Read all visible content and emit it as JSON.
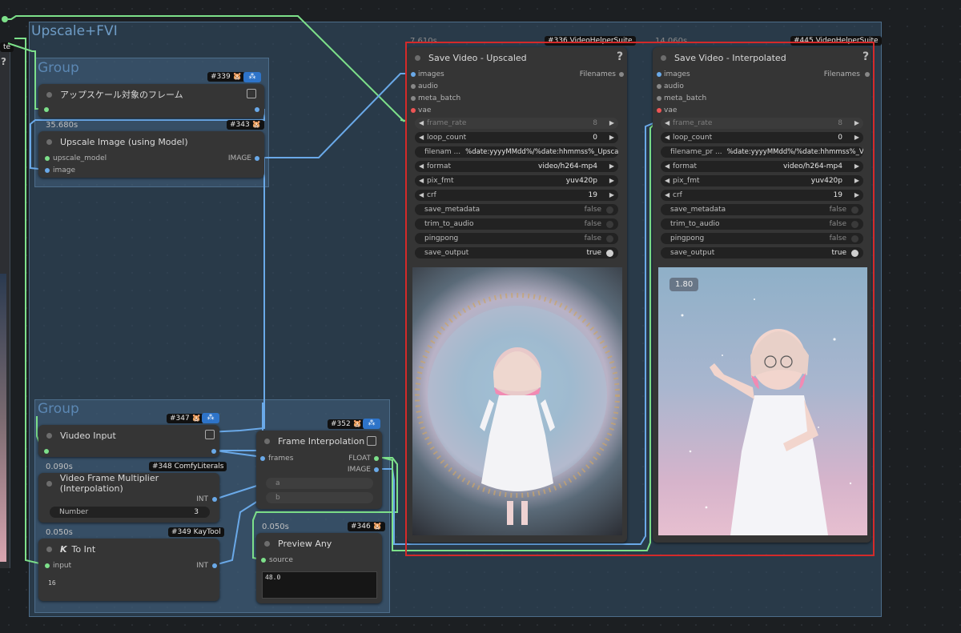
{
  "outer_group": {
    "title": "Upscale+FVI"
  },
  "group1": {
    "title": "Group"
  },
  "group2": {
    "title": "Group"
  },
  "node_339": {
    "id": "#339 🐹",
    "title": "アップスケール対象のフレーム"
  },
  "node_343": {
    "time": "35.680s",
    "id": "#343 🐹",
    "title": "Upscale Image (using Model)",
    "inputs": [
      "upscale_model",
      "image"
    ],
    "output": "IMAGE"
  },
  "node_347": {
    "id": "#347 🐹",
    "title": "Viudeo Input"
  },
  "node_348": {
    "time": "0.090s",
    "id": "#348 ComfyLiterals",
    "title": "Video Frame Multiplier (Interpolation)",
    "output": "INT",
    "widget_label": "Number",
    "widget_value": "3"
  },
  "node_349": {
    "time": "0.050s",
    "id": "#349 KayTool",
    "title": "To Int",
    "title_icon": "K",
    "input": "input",
    "output": "INT",
    "text": "16"
  },
  "node_352": {
    "id": "#352 🐹",
    "title": "Frame Interpolation",
    "input": "frames",
    "outputs": [
      "FLOAT",
      "IMAGE"
    ],
    "widgets": [
      "a",
      "b"
    ]
  },
  "node_346": {
    "time": "0.050s",
    "id": "#346 🐹",
    "title": "Preview Any",
    "input": "source",
    "text": "48.0"
  },
  "node_336": {
    "time": "7.610s",
    "id": "#336 VideoHelperSuite",
    "title": "Save Video - Upscaled",
    "help": "?",
    "inputs": [
      "images",
      "audio",
      "meta_batch",
      "vae"
    ],
    "output": "Filenames",
    "frame_rate_label": "frame_rate",
    "frame_rate_value": "8",
    "loop_count_label": "loop_count",
    "loop_count_value": "0",
    "filename_label": "filenam ...",
    "filename_value": "%date:yyyyMMdd%/%date:hhmmss%_Upscale",
    "format_label": "format",
    "format_value": "video/h264-mp4",
    "pix_fmt_label": "pix_fmt",
    "pix_fmt_value": "yuv420p",
    "crf_label": "crf",
    "crf_value": "19",
    "toggles": [
      {
        "label": "save_metadata",
        "value": "false"
      },
      {
        "label": "trim_to_audio",
        "value": "false"
      },
      {
        "label": "pingpong",
        "value": "false"
      },
      {
        "label": "save_output",
        "value": "true"
      }
    ]
  },
  "node_445": {
    "time": "14.060s",
    "id": "#445 VideoHelperSuite",
    "title": "Save Video - Interpolated",
    "help": "?",
    "inputs": [
      "images",
      "audio",
      "meta_batch",
      "vae"
    ],
    "output": "Filenames",
    "frame_rate_label": "frame_rate",
    "frame_rate_value": "8",
    "loop_count_label": "loop_count",
    "loop_count_value": "0",
    "filename_label": "filename_pr ...",
    "filename_value": "%date:yyyyMMdd%/%date:hhmmss%_VFI",
    "format_label": "format",
    "format_value": "video/h264-mp4",
    "pix_fmt_label": "pix_fmt",
    "pix_fmt_value": "yuv420p",
    "crf_label": "crf",
    "crf_value": "19",
    "toggles": [
      {
        "label": "save_metadata",
        "value": "false"
      },
      {
        "label": "trim_to_audio",
        "value": "false"
      },
      {
        "label": "pingpong",
        "value": "false"
      },
      {
        "label": "save_output",
        "value": "true"
      }
    ],
    "preview_badge": "1.80"
  },
  "left_edge": {
    "tag": "te",
    "help": "?"
  },
  "colors": {
    "accent_blue": "#2e74c9",
    "link_green": "#7de08a",
    "link_blue": "#6aa9e8",
    "highlight_red": "#d42a2a"
  }
}
